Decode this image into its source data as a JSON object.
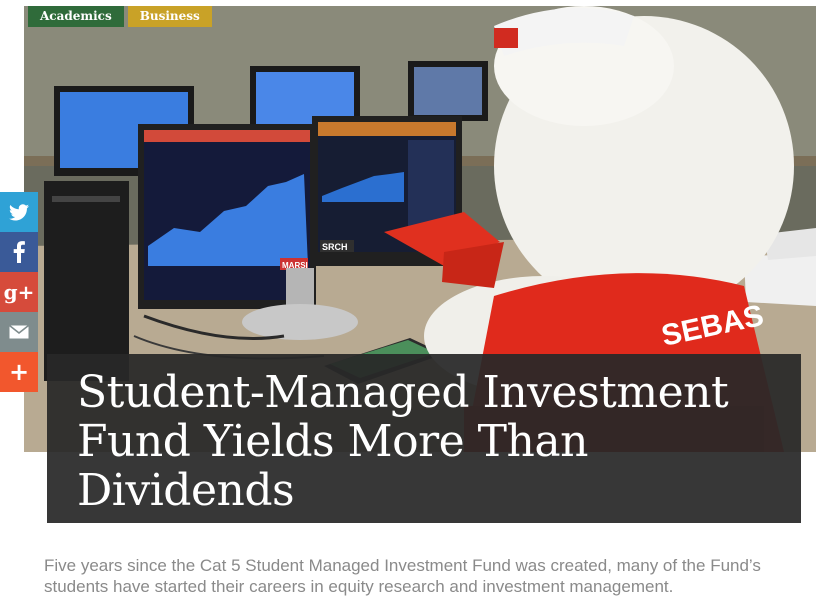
{
  "tags": {
    "academics": "Academics",
    "business": "Business"
  },
  "share": {
    "items": [
      "twitter",
      "facebook",
      "google-plus",
      "email",
      "more"
    ],
    "gplus_glyph": "g+",
    "more_glyph": "+"
  },
  "hero": {
    "jersey_text": "SEBAS",
    "screen_label": "SRCH",
    "screen_label_right": "MARSI"
  },
  "article": {
    "title": "Student-Managed Investment Fund Yields More Than Dividends",
    "dek": "Five years since the Cat 5 Student Managed Investment Fund was created, many of the Fund’s students have started their careers in equity research and investment management."
  },
  "colors": {
    "academics": "#2f6b3a",
    "business": "#c9a227",
    "twitter": "#2fa2d6",
    "facebook": "#3a5a98",
    "gplus": "#d64b3b",
    "email": "#7f8c8d",
    "more": "#f2572d"
  }
}
